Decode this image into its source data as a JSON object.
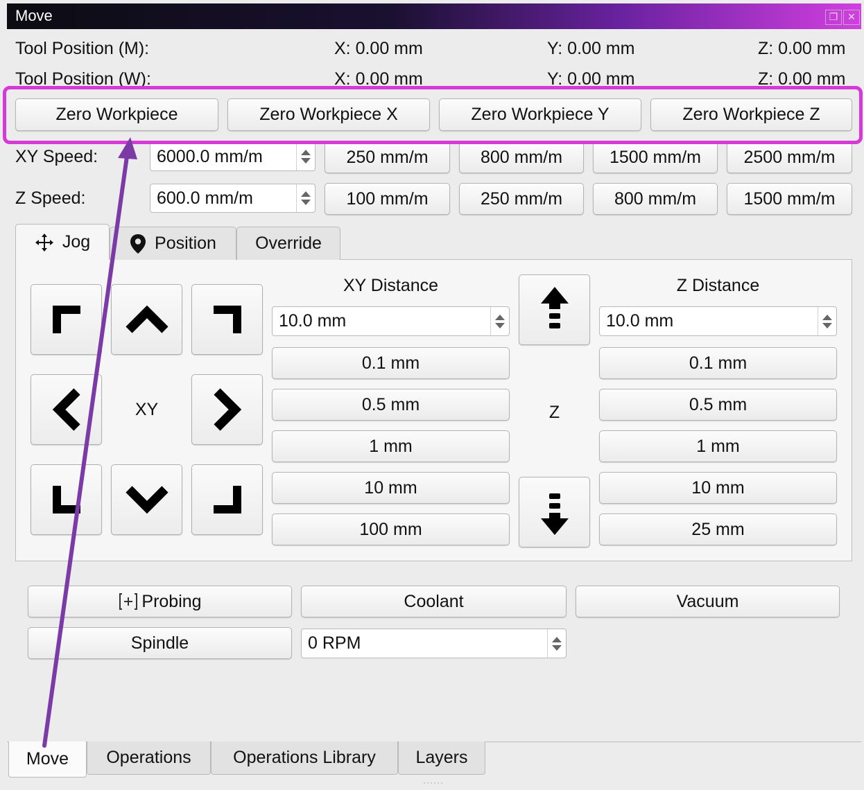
{
  "window": {
    "title": "Move"
  },
  "tool_position": {
    "machine": {
      "label": "Tool Position (M):",
      "x": "X: 0.00 mm",
      "y": "Y: 0.00 mm",
      "z": "Z: 0.00 mm"
    },
    "workpiece": {
      "label": "Tool Position (W):",
      "x": "X: 0.00 mm",
      "y": "Y: 0.00 mm",
      "z": "Z: 0.00 mm"
    }
  },
  "zero_buttons": [
    "Zero Workpiece",
    "Zero Workpiece X",
    "Zero Workpiece Y",
    "Zero Workpiece Z"
  ],
  "xy_speed": {
    "label": "XY Speed:",
    "value": "6000.0 mm/m",
    "presets": [
      "250 mm/m",
      "800 mm/m",
      "1500 mm/m",
      "2500 mm/m"
    ]
  },
  "z_speed": {
    "label": "Z Speed:",
    "value": "600.0 mm/m",
    "presets": [
      "100 mm/m",
      "250 mm/m",
      "800 mm/m",
      "1500 mm/m"
    ]
  },
  "tabs": [
    "Jog",
    "Position",
    "Override"
  ],
  "jog": {
    "xy_center": "XY",
    "z_center": "Z",
    "xy_distance": {
      "title": "XY Distance",
      "value": "10.0 mm",
      "presets": [
        "0.1 mm",
        "0.5 mm",
        "1 mm",
        "10 mm",
        "100 mm"
      ]
    },
    "z_distance": {
      "title": "Z Distance",
      "value": "10.0 mm",
      "presets": [
        "0.1 mm",
        "0.5 mm",
        "1 mm",
        "10 mm",
        "25 mm"
      ]
    }
  },
  "controls": {
    "probing": "Probing",
    "coolant": "Coolant",
    "vacuum": "Vacuum",
    "spindle": "Spindle",
    "spindle_rpm": "0 RPM"
  },
  "bottom_tabs": [
    "Move",
    "Operations",
    "Operations Library",
    "Layers"
  ],
  "colors": {
    "highlight": "#d63ad6",
    "arrow": "#7b3aa6"
  }
}
